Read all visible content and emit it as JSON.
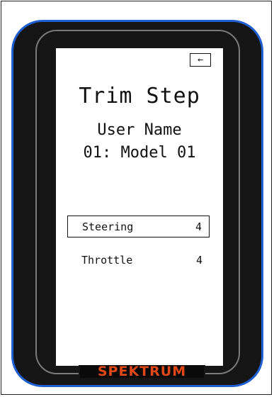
{
  "screen": {
    "back_icon": "left-arrow-icon",
    "back_glyph": "←",
    "title": "Trim Step",
    "user_name": "User Name",
    "model": "01: Model 01"
  },
  "menu": {
    "items": [
      {
        "label": "Steering",
        "value": "4",
        "selected": true
      },
      {
        "label": "Throttle",
        "value": "4",
        "selected": false
      }
    ]
  },
  "device": {
    "brand": "SPEKTRUM",
    "brand_color": "#e04818",
    "body_color": "#151515",
    "accent_color": "#1f5fd0"
  }
}
